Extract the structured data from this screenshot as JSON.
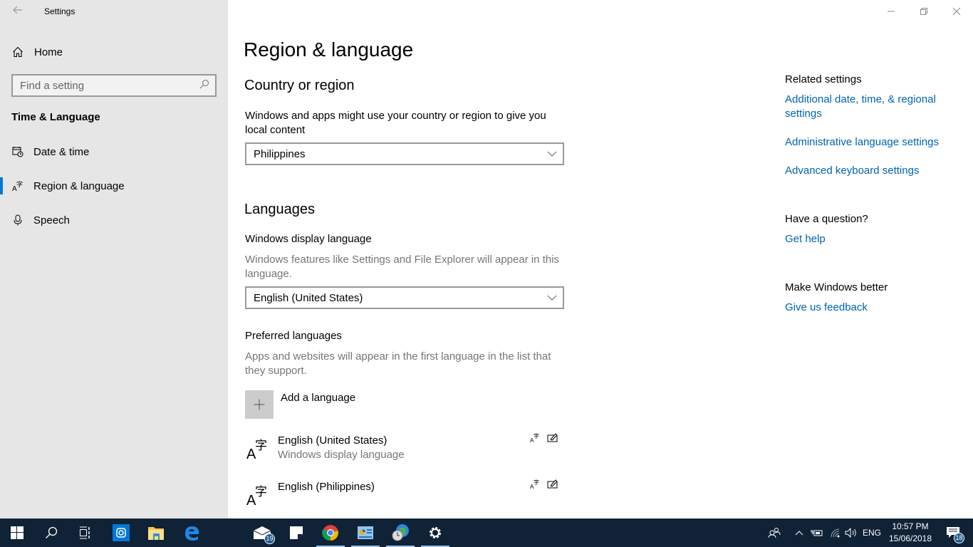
{
  "window": {
    "title": "Settings",
    "controls": {
      "minimize": "minimize",
      "restore": "restore",
      "close": "close"
    }
  },
  "sidebar": {
    "home_label": "Home",
    "search_placeholder": "Find a setting",
    "search_value": "",
    "section_title": "Time & Language",
    "items": [
      {
        "label": "Date & time",
        "icon": "calendar-clock-icon",
        "active": false
      },
      {
        "label": "Region & language",
        "icon": "language-icon",
        "active": true
      },
      {
        "label": "Speech",
        "icon": "microphone-icon",
        "active": false
      }
    ],
    "accent": "#0078d7"
  },
  "main": {
    "page_title": "Region & language",
    "country": {
      "heading": "Country or region",
      "description": "Windows and apps might use your country or region to give you local content",
      "selected": "Philippines"
    },
    "languages": {
      "heading": "Languages",
      "display_label": "Windows display language",
      "display_description": "Windows features like Settings and File Explorer will appear in this language.",
      "display_selected": "English (United States)",
      "preferred_label": "Preferred languages",
      "preferred_description": "Apps and websites will appear in the first language in the list that they support.",
      "add_label": "Add a language",
      "list": [
        {
          "name": "English (United States)",
          "subtitle": "Windows display language"
        },
        {
          "name": "English (Philippines)",
          "subtitle": ""
        }
      ]
    }
  },
  "related": {
    "heading": "Related settings",
    "links": [
      "Additional date, time, & regional settings",
      "Administrative language settings",
      "Advanced keyboard settings"
    ],
    "question_heading": "Have a question?",
    "help_link": "Get help",
    "better_heading": "Make Windows better",
    "feedback_link": "Give us feedback",
    "link_color": "#0063b1"
  },
  "taskbar": {
    "mail_badge": "19",
    "notifications_badge": "18",
    "language": "ENG",
    "time": "10:57 PM",
    "date": "15/06/2018"
  }
}
